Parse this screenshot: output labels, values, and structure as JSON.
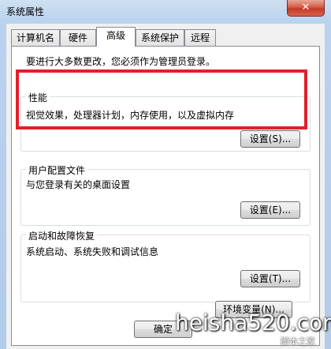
{
  "window": {
    "title": "系统属性",
    "close_glyph": "✕"
  },
  "tabs": [
    {
      "label": "计算机名"
    },
    {
      "label": "硬件"
    },
    {
      "label": "高级",
      "active": true
    },
    {
      "label": "系统保护"
    },
    {
      "label": "远程"
    }
  ],
  "admin_notice": "要进行大多数更改，您必须作为管理员登录。",
  "performance": {
    "title": "性能",
    "description": "视觉效果，处理器计划，内存使用，以及虚拟内存",
    "settings_button": "设置(S)..."
  },
  "user_profiles": {
    "title": "用户配置文件",
    "description": "与您登录有关的桌面设置",
    "settings_button": "设置(E)..."
  },
  "startup_recovery": {
    "title": "启动和故障恢复",
    "description": "系统启动、系统失败和调试信息",
    "settings_button": "设置(T)..."
  },
  "env_button": "环境变量(N)...",
  "footer": {
    "ok_button": "确定"
  },
  "watermark": {
    "text": "heisha520.com",
    "sub": "脚本之家"
  },
  "colors": {
    "highlight_box": "#e0202c",
    "titlebar": "#bad2ee",
    "close_button": "#c43a26"
  }
}
